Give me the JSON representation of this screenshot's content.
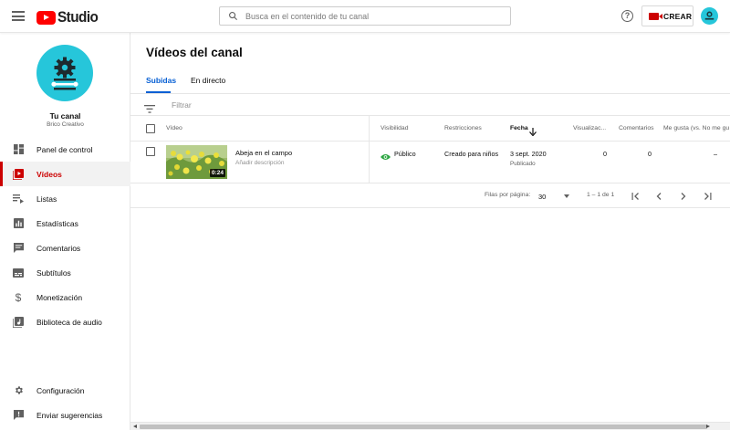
{
  "header": {
    "logo_text": "Studio",
    "search_placeholder": "Busca en el contenido de tu canal",
    "help_glyph": "?",
    "create_label": "CREAR"
  },
  "sidebar": {
    "channel_name": "Tu canal",
    "channel_subtitle": "Brico Creativo",
    "items": [
      {
        "label": "Panel de control",
        "icon": "dashboard-icon",
        "active": false
      },
      {
        "label": "Vídeos",
        "icon": "videos-icon",
        "active": true
      },
      {
        "label": "Listas",
        "icon": "playlists-icon",
        "active": false
      },
      {
        "label": "Estadísticas",
        "icon": "analytics-icon",
        "active": false
      },
      {
        "label": "Comentarios",
        "icon": "comments-icon",
        "active": false
      },
      {
        "label": "Subtítulos",
        "icon": "subtitles-icon",
        "active": false
      },
      {
        "label": "Monetización",
        "icon": "dollar-icon",
        "active": false
      },
      {
        "label": "Biblioteca de audio",
        "icon": "audio-library-icon",
        "active": false
      }
    ],
    "bottom_items": [
      {
        "label": "Configuración",
        "icon": "gear-icon"
      },
      {
        "label": "Enviar sugerencias",
        "icon": "feedback-icon"
      }
    ]
  },
  "main": {
    "title": "Vídeos del canal",
    "tabs": [
      {
        "label": "Subidas",
        "active": true
      },
      {
        "label": "En directo",
        "active": false
      }
    ],
    "filter_placeholder": "Filtrar",
    "columns": {
      "video": "Vídeo",
      "visibility": "Visibilidad",
      "restrictions": "Restricciones",
      "date": "Fecha",
      "views": "Visualizac...",
      "comments": "Comentarios",
      "likes": "Me gusta (vs. No me gu"
    },
    "rows": [
      {
        "title": "Abeja en el campo",
        "description": "Añadir descripción",
        "duration": "0:24",
        "visibility": "Público",
        "restrictions": "Creado para niños",
        "date": "3 sept. 2020",
        "date_status": "Publicado",
        "views": "0",
        "comments": "0",
        "likes": "–"
      }
    ],
    "pagination": {
      "rows_per_page_label": "Filas por página:",
      "rows_per_page": "30",
      "range": "1 – 1 de 1"
    }
  },
  "colors": {
    "accent_red": "#cc0000",
    "link_blue": "#065fd4",
    "avatar_teal": "#26c6da",
    "public_green": "#2ba640"
  }
}
